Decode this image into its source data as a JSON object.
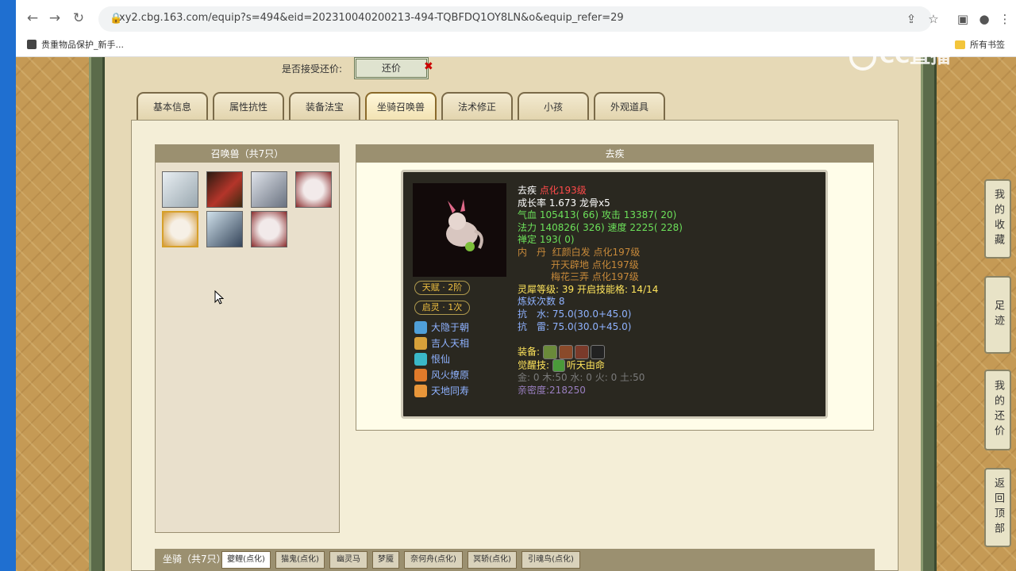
{
  "browser": {
    "url": "xy2.cbg.163.com/equip?s=494&eid=202310040200213-494-TQBFDQ1OY8LN&o&equip_refer=29",
    "bookmark": "贵重物品保护_新手...",
    "bookmark_right": "所有书签"
  },
  "watermark": "CC直播",
  "haggle": {
    "label": "是否接受还价:",
    "button": "还价"
  },
  "tabs": [
    "基本信息",
    "属性抗性",
    "装备法宝",
    "坐骑召唤兽",
    "法术修正",
    "小孩",
    "外观道具"
  ],
  "summons": {
    "title": "召唤兽（共7只）",
    "count": 7
  },
  "detail": {
    "title": "去疾",
    "name": "去疾",
    "name_tag": "点化193级",
    "growth": "成长率 1.673 龙骨x5",
    "hp": "气血 105413( 66)",
    "atk": "攻击 13387( 20)",
    "mp": "法力 140826( 326)",
    "spd": "速度 2225( 228)",
    "zen": "禅定 193( 0)",
    "neidan_label": "内　丹",
    "neidan": [
      "红颜白发 点化197级",
      "开天辟地 点化197级",
      "梅花三弄 点化197级"
    ],
    "lingxi": "灵犀等级:  39 开启技能格:  14/14",
    "lianyao": "炼妖次数 8",
    "resist1": "抗　水: 75.0(30.0+45.0)",
    "resist2": "抗　雷: 75.0(30.0+45.0)",
    "equip_label": "装备:",
    "awaken_label": "觉醒技:",
    "awaken": "听天由命",
    "elements": "金: 0 木:50 水: 0 火: 0 土:50",
    "intimacy": "亲密度:218250",
    "talent": "天赋 · 2阶",
    "qiling": "启灵 · 1次",
    "skills": [
      "大隐于朝",
      "吉人天相",
      "恨仙",
      "风火燎原",
      "天地同寿"
    ]
  },
  "side": [
    "我的收藏",
    "足迹",
    "我的还价",
    "返回顶部"
  ],
  "mounts": {
    "title": "坐骑（共7只）",
    "tabs": [
      "夔鲤(点化)",
      "猫鬼(点化)",
      "幽灵马",
      "梦魇",
      "奈何舟(点化)",
      "冥轿(点化)",
      "引魂鸟(点化)"
    ]
  }
}
